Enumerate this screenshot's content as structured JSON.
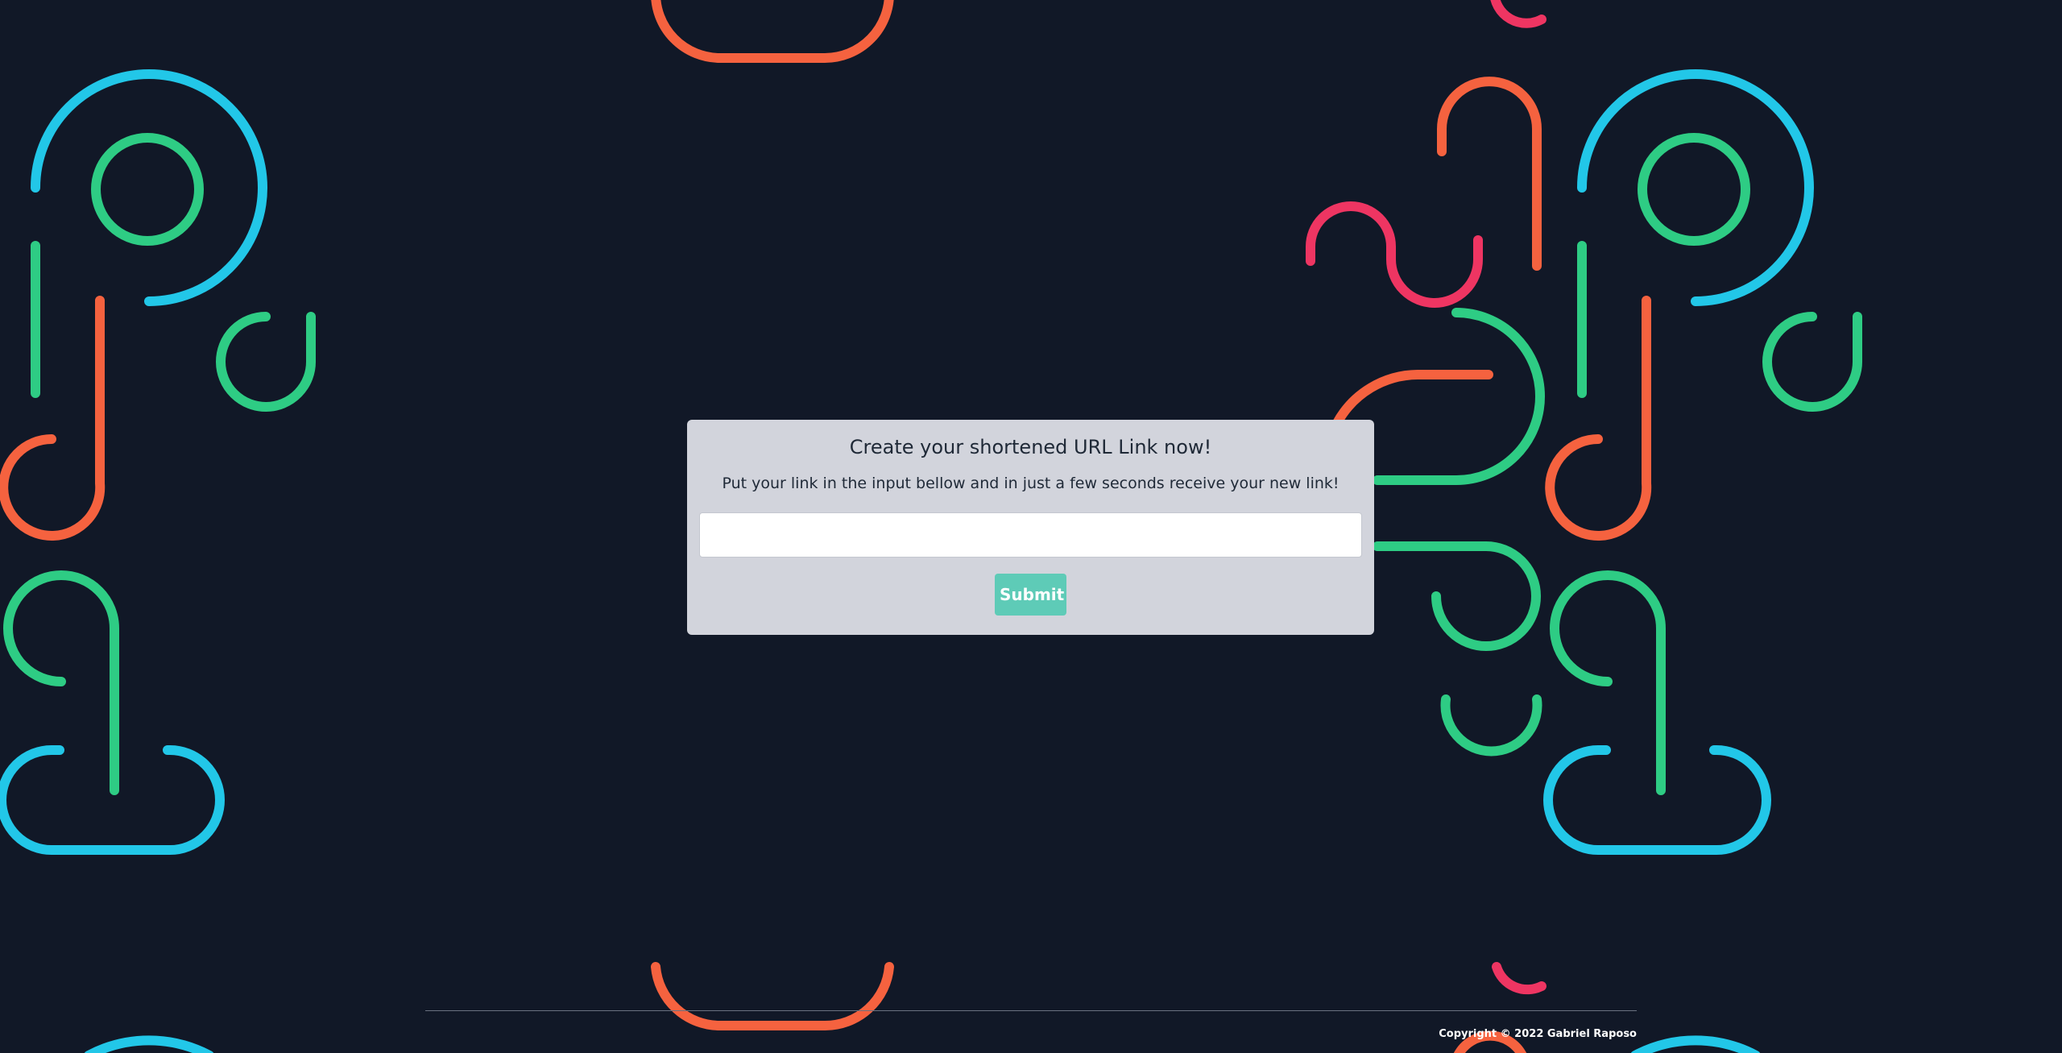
{
  "card": {
    "title": "Create your shortened URL Link now!",
    "subtitle": "Put your link in the input bellow and in just a few seconds receive your new link!",
    "input_value": "",
    "input_placeholder": "",
    "submit_label": "Submit"
  },
  "footer": {
    "copyright": "Copyright © 2022 Gabriel Raposo"
  },
  "colors": {
    "background": "#111827",
    "card": "#d2d4dc",
    "submit": "#5ecbb7",
    "pattern_blue": "#22c7e8",
    "pattern_green": "#2ecc84",
    "pattern_orange": "#f5623f",
    "pattern_pink": "#ee3562"
  }
}
